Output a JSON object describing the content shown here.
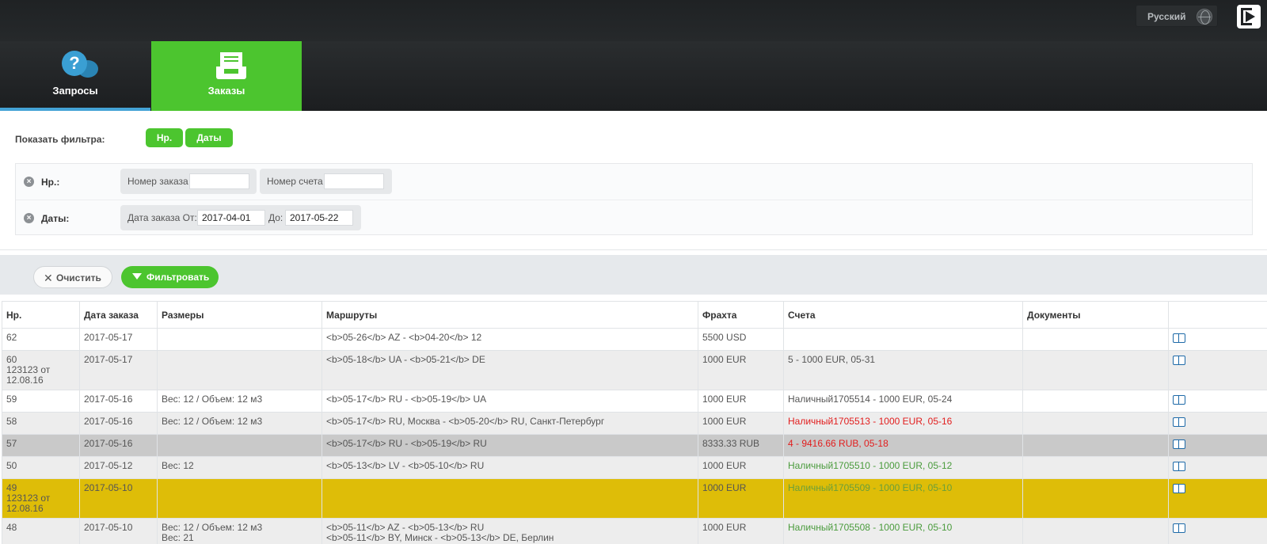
{
  "header": {
    "language": "Русский"
  },
  "nav": {
    "tabs": [
      {
        "label": "Запросы",
        "icon": "question-bubble-icon"
      },
      {
        "label": "Заказы",
        "icon": "inbox-icon",
        "active": true
      }
    ]
  },
  "filters": {
    "show_label": "Показать фильтра:",
    "pills": [
      "Нр.",
      "Даты"
    ],
    "nr": {
      "label": "Нр.:",
      "order_number_label": "Номер заказа",
      "order_number_value": "",
      "invoice_number_label": "Номер счета",
      "invoice_number_value": ""
    },
    "dates": {
      "label": "Даты:",
      "from_label": "Дата заказа От:",
      "from_value": "2017-04-01",
      "to_label": "До:",
      "to_value": "2017-05-22"
    }
  },
  "actions": {
    "clear": "Очистить",
    "filter": "Фильтровать"
  },
  "table": {
    "columns": [
      "Нр.",
      "Дата заказа",
      "Размеры",
      "Маршруты",
      "Фрахта",
      "Счета",
      "Документы",
      ""
    ],
    "rows": [
      {
        "nr": "62",
        "date": "2017-05-17",
        "sizes": "",
        "route": "<b>05-26</b> AZ - <b>04-20</b> 12",
        "freight": "5500 USD",
        "invoice": "",
        "docs": ""
      },
      {
        "nr": "60\n123123 от\n12.08.16",
        "date": "2017-05-17",
        "sizes": "",
        "route": "<b>05-18</b> UA - <b>05-21</b> DE",
        "freight": "1000 EUR",
        "invoice": "5 - 1000 EUR, 05-31",
        "docs": ""
      },
      {
        "nr": "59",
        "date": "2017-05-16",
        "sizes": "Вес: 12 / Объем: 12 м3",
        "route": "<b>05-17</b> RU - <b>05-19</b> UA",
        "freight": "1000 EUR",
        "invoice": "Наличный1705514 - 1000 EUR, 05-24",
        "docs": ""
      },
      {
        "nr": "58",
        "date": "2017-05-16",
        "sizes": "Вес: 12 / Объем: 12 м3",
        "route": "<b>05-17</b> RU, Москва - <b>05-20</b> RU, Санкт-Петербург",
        "freight": "1000 EUR",
        "invoice": "Наличный1705513 - 1000 EUR, 05-16",
        "docs": ""
      },
      {
        "nr": "57",
        "date": "2017-05-16",
        "sizes": "",
        "route": "<b>05-17</b> RU - <b>05-19</b> RU",
        "freight": "8333.33 RUB",
        "invoice": "4 - 9416.66 RUB, 05-18",
        "docs": ""
      },
      {
        "nr": "50",
        "date": "2017-05-12",
        "sizes": "Вес: 12",
        "route": "<b>05-13</b> LV - <b>05-10</b> RU",
        "freight": "1000 EUR",
        "invoice": "Наличный1705510 - 1000 EUR, 05-12",
        "docs": ""
      },
      {
        "nr": "49\n123123 от\n12.08.16",
        "date": "2017-05-10",
        "sizes": "",
        "route": "",
        "freight": "1000 EUR",
        "invoice": "Наличный1705509 - 1000 EUR, 05-10",
        "docs": ""
      },
      {
        "nr": "48",
        "date": "2017-05-10",
        "sizes": "Вес: 12 / Объем: 12 м3\nВес: 21",
        "route": "<b>05-11</b> AZ - <b>05-13</b> RU\n<b>05-11</b> BY, Минск - <b>05-13</b> DE, Берлин",
        "freight": "1000 EUR",
        "invoice": "Наличный1705508 - 1000 EUR, 05-10",
        "docs": ""
      }
    ]
  },
  "colors": {
    "accent_green": "#4cc52f",
    "tab_underline": "#44a3d6",
    "highlight_yellow": "#debd08",
    "invoice_red": "#e21d1d",
    "invoice_green": "#4a9b3c"
  }
}
